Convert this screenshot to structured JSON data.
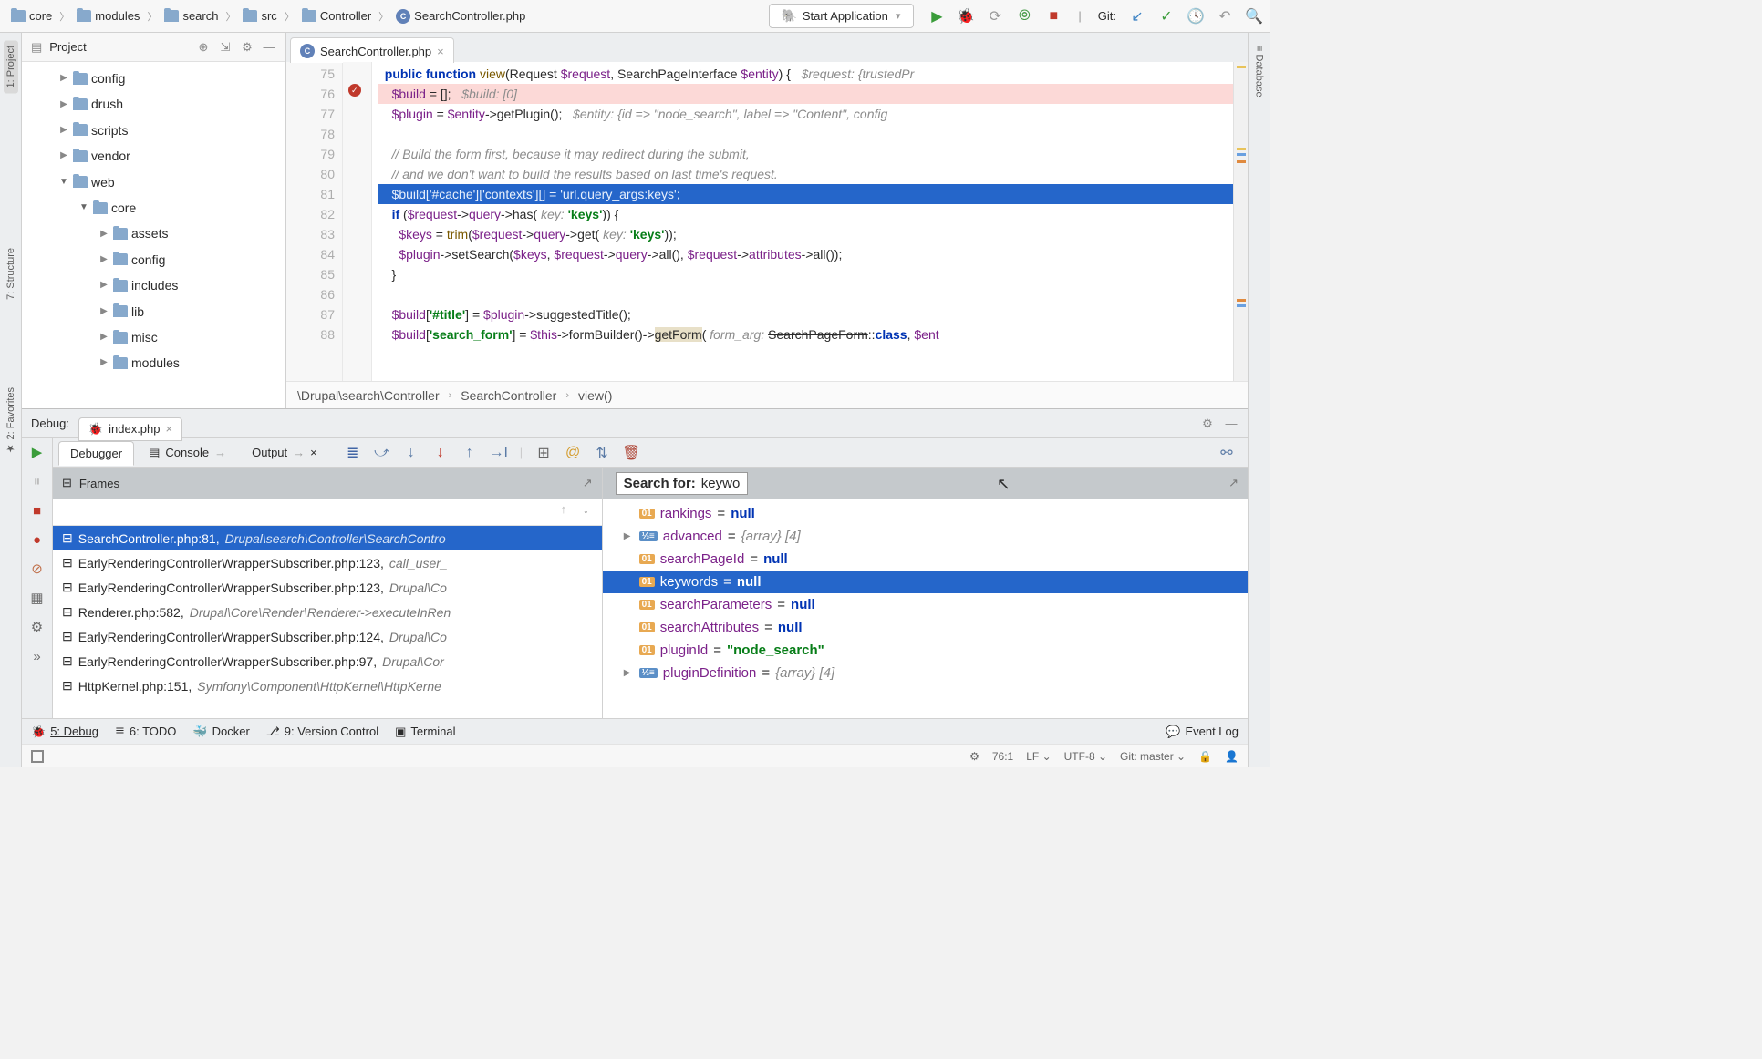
{
  "breadcrumbs": [
    "core",
    "modules",
    "search",
    "src",
    "Controller",
    "SearchController.php"
  ],
  "run_config": "Start Application",
  "git_label": "Git:",
  "project": {
    "title": "Project",
    "tree": [
      {
        "name": "config",
        "depth": 1,
        "open": false
      },
      {
        "name": "drush",
        "depth": 1,
        "open": false
      },
      {
        "name": "scripts",
        "depth": 1,
        "open": false
      },
      {
        "name": "vendor",
        "depth": 1,
        "open": false
      },
      {
        "name": "web",
        "depth": 1,
        "open": true
      },
      {
        "name": "core",
        "depth": 2,
        "open": true
      },
      {
        "name": "assets",
        "depth": 3,
        "open": false
      },
      {
        "name": "config",
        "depth": 3,
        "open": false
      },
      {
        "name": "includes",
        "depth": 3,
        "open": false
      },
      {
        "name": "lib",
        "depth": 3,
        "open": false
      },
      {
        "name": "misc",
        "depth": 3,
        "open": false
      },
      {
        "name": "modules",
        "depth": 3,
        "open": false
      }
    ]
  },
  "left_tabs": [
    "1: Project",
    "7: Structure",
    "2: Favorites"
  ],
  "right_tabs": [
    "Database"
  ],
  "editor": {
    "tab": "SearchController.php",
    "lines": [
      {
        "n": 75,
        "html": "  <span class='kw'>public function</span> <span class='fn'>view</span>(Request <span class='var'>$request</span>, SearchPageInterface <span class='var'>$entity</span>) {   <span class='hint'>$request: {trustedPr</span>",
        "cls": ""
      },
      {
        "n": 76,
        "html": "    <span class='var'>$build</span> = [];   <span class='hint'>$build: [0]</span>",
        "cls": "hl-warn"
      },
      {
        "n": 77,
        "html": "    <span class='var'>$plugin</span> = <span class='var'>$entity</span>->getPlugin();   <span class='hint'>$entity: {id =&gt; \"node_search\", label =&gt; \"Content\", config</span>",
        "cls": ""
      },
      {
        "n": 78,
        "html": "",
        "cls": ""
      },
      {
        "n": 79,
        "html": "    <span class='cm'>// Build the form first, because it may redirect during the submit,</span>",
        "cls": ""
      },
      {
        "n": 80,
        "html": "    <span class='cm'>// and we don't want to build the results based on last time's request.</span>",
        "cls": ""
      },
      {
        "n": 81,
        "html": "    $build['#cache']['contexts'][] = 'url.query_args:keys';",
        "cls": "hl-exec"
      },
      {
        "n": 82,
        "html": "    <span class='kw'>if</span> (<span class='var'>$request</span>-><span class='var'>query</span>->has( <span class='hint'>key:</span> <span class='str'>'keys'</span>)) {",
        "cls": ""
      },
      {
        "n": 83,
        "html": "      <span class='var'>$keys</span> = <span class='fn'>trim</span>(<span class='var'>$request</span>-><span class='var'>query</span>->get( <span class='hint'>key:</span> <span class='str'>'keys'</span>));",
        "cls": ""
      },
      {
        "n": 84,
        "html": "      <span class='var'>$plugin</span>->setSearch(<span class='var'>$keys</span>, <span class='var'>$request</span>-><span class='var'>query</span>->all(), <span class='var'>$request</span>-><span class='var'>attributes</span>->all());",
        "cls": ""
      },
      {
        "n": 85,
        "html": "    }",
        "cls": ""
      },
      {
        "n": 86,
        "html": "",
        "cls": ""
      },
      {
        "n": 87,
        "html": "    <span class='var'>$build</span>[<span class='str'>'#title'</span>] = <span class='var'>$plugin</span>->suggestedTitle();",
        "cls": ""
      },
      {
        "n": 88,
        "html": "    <span class='var'>$build</span>[<span class='str'>'search_form'</span>] = <span class='var'>$this</span>->formBuilder()-><span style='background:#e8e0c8'>getForm</span>( <span class='hint'>form_arg:</span> <span style='text-decoration:line-through'>SearchPageForm</span>::<span class='kw'>class</span>, <span class='var'>$ent</span>",
        "cls": ""
      }
    ],
    "context": [
      "\\Drupal\\search\\Controller",
      "SearchController",
      "view()"
    ]
  },
  "debug": {
    "label": "Debug:",
    "session": "index.php",
    "tabs": [
      "Debugger",
      "Console",
      "Output"
    ],
    "frames_label": "Frames",
    "frames": [
      {
        "file": "SearchController.php:81",
        "loc": "Drupal\\search\\Controller\\SearchContro",
        "sel": true
      },
      {
        "file": "EarlyRenderingControllerWrapperSubscriber.php:123",
        "loc": "call_user_",
        "sel": false
      },
      {
        "file": "EarlyRenderingControllerWrapperSubscriber.php:123",
        "loc": "Drupal\\Co",
        "sel": false
      },
      {
        "file": "Renderer.php:582",
        "loc": "Drupal\\Core\\Render\\Renderer->executeInRen",
        "sel": false
      },
      {
        "file": "EarlyRenderingControllerWrapperSubscriber.php:124",
        "loc": "Drupal\\Co",
        "sel": false
      },
      {
        "file": "EarlyRenderingControllerWrapperSubscriber.php:97",
        "loc": "Drupal\\Cor",
        "sel": false
      },
      {
        "file": "HttpKernel.php:151",
        "loc": "Symfony\\Component\\HttpKernel\\HttpKerne",
        "sel": false
      }
    ],
    "search_label": "Search for:",
    "search_value": "keywo",
    "vars": [
      {
        "name": "rankings",
        "val": "null",
        "type": "null",
        "exp": ""
      },
      {
        "name": "advanced",
        "val": "{array} [4]",
        "type": "array",
        "exp": "▶"
      },
      {
        "name": "searchPageId",
        "val": "null",
        "type": "null",
        "exp": ""
      },
      {
        "name": "keywords",
        "val": "null",
        "type": "null",
        "exp": "",
        "sel": true
      },
      {
        "name": "searchParameters",
        "val": "null",
        "type": "null",
        "exp": ""
      },
      {
        "name": "searchAttributes",
        "val": "null",
        "type": "null",
        "exp": ""
      },
      {
        "name": "pluginId",
        "val": "\"node_search\"",
        "type": "string",
        "exp": ""
      },
      {
        "name": "pluginDefinition",
        "val": "{array} [4]",
        "type": "array",
        "exp": "▶"
      }
    ]
  },
  "footer": {
    "items": [
      "5: Debug",
      "6: TODO",
      "Docker",
      "9: Version Control",
      "Terminal"
    ],
    "event_log": "Event Log"
  },
  "status": {
    "pos": "76:1",
    "lf": "LF",
    "enc": "UTF-8",
    "branch": "Git: master"
  }
}
